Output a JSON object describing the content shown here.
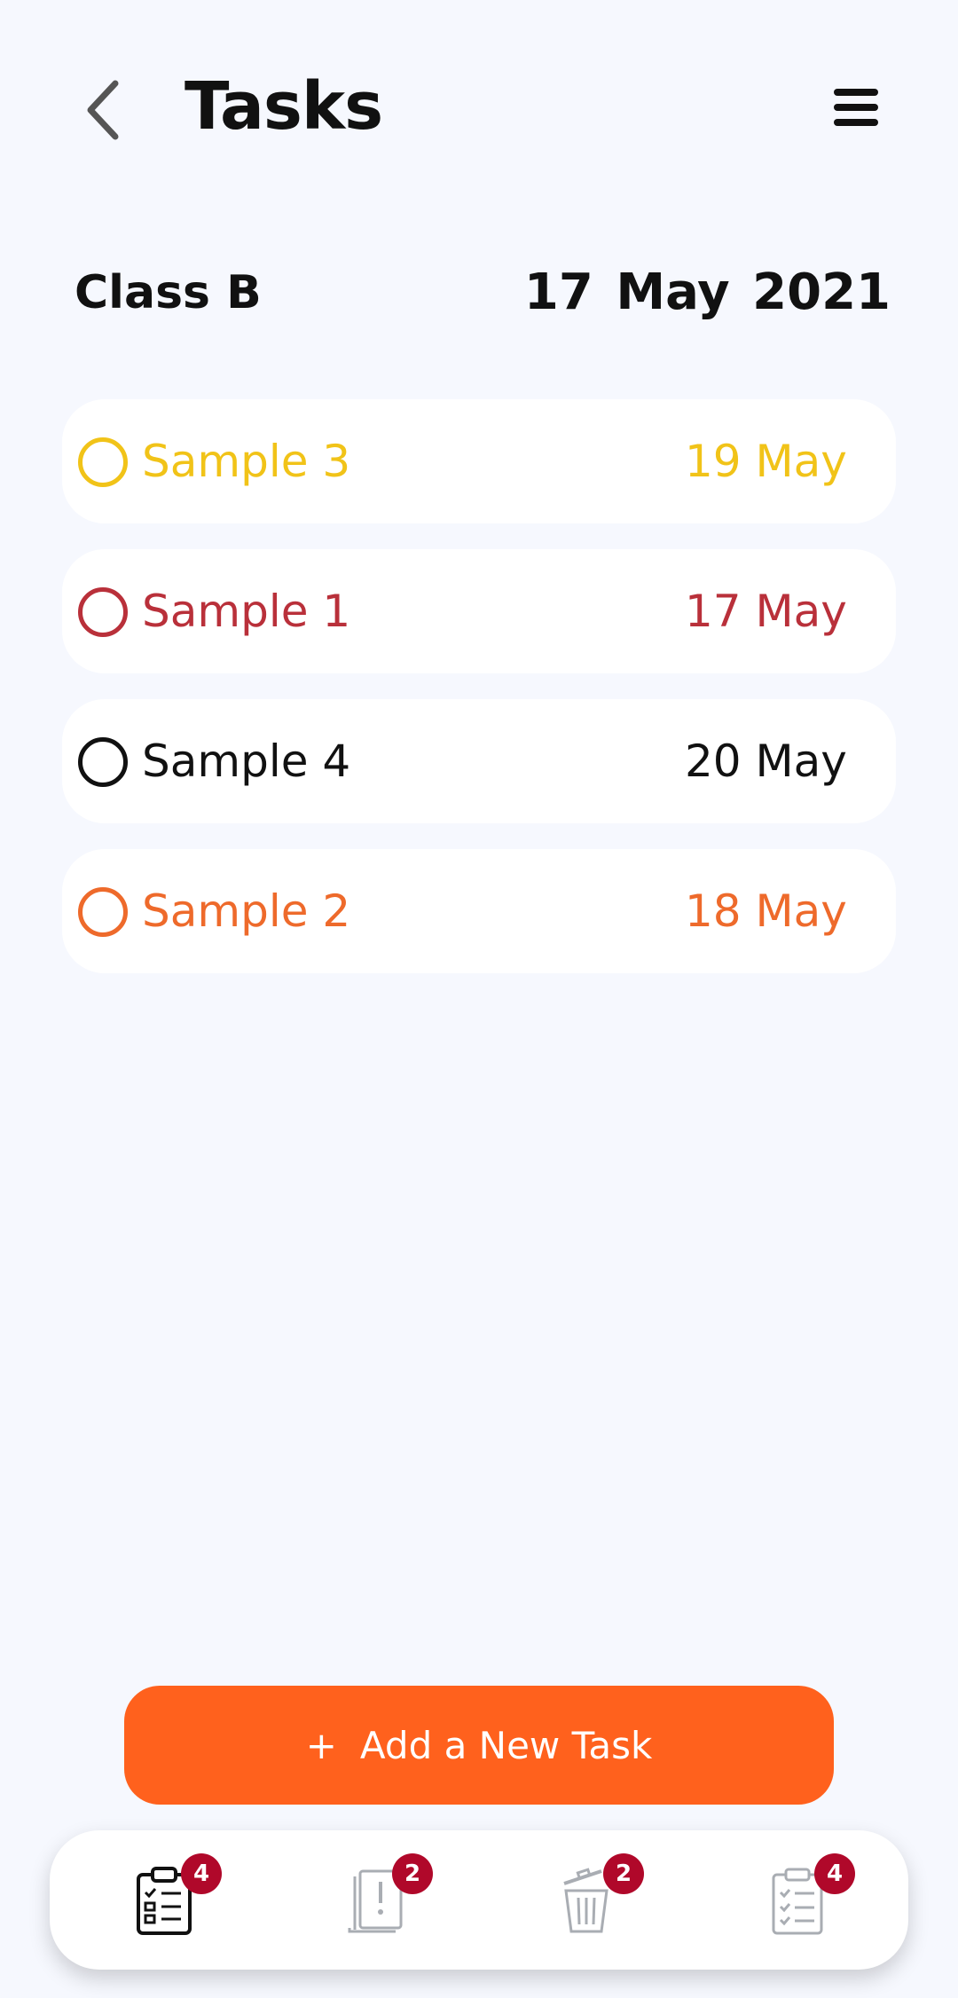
{
  "header": {
    "title": "Tasks",
    "back_icon": "chevron-left-icon",
    "menu_icon": "hamburger-menu-icon"
  },
  "class_info": {
    "name": "Class B",
    "date": "17 May 2021"
  },
  "tasks": [
    {
      "name": "Sample 3",
      "date": "19 May",
      "color": "#f1c318"
    },
    {
      "name": "Sample 1",
      "date": "17 May",
      "color": "#b9303a"
    },
    {
      "name": "Sample 4",
      "date": "20 May",
      "color": "#111111"
    },
    {
      "name": "Sample 2",
      "date": "18 May",
      "color": "#ee6a2b"
    }
  ],
  "add_button": {
    "plus": "+",
    "label": "Add a New Task",
    "color": "#ff611d"
  },
  "bottom_nav": [
    {
      "icon": "clipboard-checklist-icon",
      "badge": "4",
      "active": true
    },
    {
      "icon": "alert-document-icon",
      "badge": "2",
      "active": false
    },
    {
      "icon": "trash-bin-icon",
      "badge": "2",
      "active": false
    },
    {
      "icon": "completed-checklist-icon",
      "badge": "4",
      "active": false
    }
  ],
  "colors": {
    "background": "#f6f8fe",
    "badge": "#b0082a",
    "inactive_icon": "#a9adb3"
  }
}
